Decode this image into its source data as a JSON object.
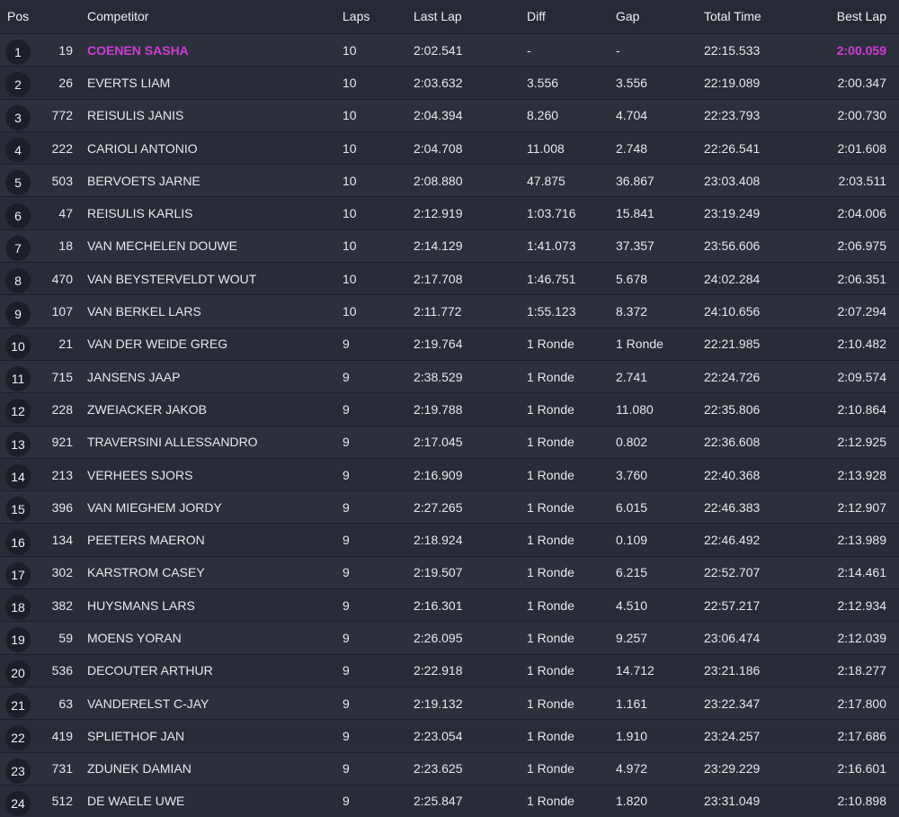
{
  "header": {
    "pos": "Pos",
    "competitor": "Competitor",
    "laps": "Laps",
    "last_lap": "Last Lap",
    "diff": "Diff",
    "gap": "Gap",
    "total_time": "Total Time",
    "best_lap": "Best Lap"
  },
  "colors": {
    "background": "#252a34",
    "row_odd": "#2b303b",
    "row_even": "#272c36",
    "highlight": "#d13ad6",
    "badge": "#1b1f27"
  },
  "rows": [
    {
      "pos": "1",
      "number": "19",
      "name": "COENEN SASHA",
      "laps": "10",
      "last_lap": "2:02.541",
      "diff": "-",
      "gap": "-",
      "total_time": "22:15.533",
      "best_lap": "2:00.059",
      "highlight": true
    },
    {
      "pos": "2",
      "number": "26",
      "name": "EVERTS LIAM",
      "laps": "10",
      "last_lap": "2:03.632",
      "diff": "3.556",
      "gap": "3.556",
      "total_time": "22:19.089",
      "best_lap": "2:00.347"
    },
    {
      "pos": "3",
      "number": "772",
      "name": "REISULIS JANIS",
      "laps": "10",
      "last_lap": "2:04.394",
      "diff": "8.260",
      "gap": "4.704",
      "total_time": "22:23.793",
      "best_lap": "2:00.730"
    },
    {
      "pos": "4",
      "number": "222",
      "name": "CARIOLI ANTONIO",
      "laps": "10",
      "last_lap": "2:04.708",
      "diff": "11.008",
      "gap": "2.748",
      "total_time": "22:26.541",
      "best_lap": "2:01.608"
    },
    {
      "pos": "5",
      "number": "503",
      "name": "BERVOETS JARNE",
      "laps": "10",
      "last_lap": "2:08.880",
      "diff": "47.875",
      "gap": "36.867",
      "total_time": "23:03.408",
      "best_lap": "2:03.511"
    },
    {
      "pos": "6",
      "number": "47",
      "name": "REISULIS KARLIS",
      "laps": "10",
      "last_lap": "2:12.919",
      "diff": "1:03.716",
      "gap": "15.841",
      "total_time": "23:19.249",
      "best_lap": "2:04.006"
    },
    {
      "pos": "7",
      "number": "18",
      "name": "VAN MECHELEN DOUWE",
      "laps": "10",
      "last_lap": "2:14.129",
      "diff": "1:41.073",
      "gap": "37.357",
      "total_time": "23:56.606",
      "best_lap": "2:06.975"
    },
    {
      "pos": "8",
      "number": "470",
      "name": "VAN BEYSTERVELDT WOUT",
      "laps": "10",
      "last_lap": "2:17.708",
      "diff": "1:46.751",
      "gap": "5.678",
      "total_time": "24:02.284",
      "best_lap": "2:06.351"
    },
    {
      "pos": "9",
      "number": "107",
      "name": "VAN BERKEL LARS",
      "laps": "10",
      "last_lap": "2:11.772",
      "diff": "1:55.123",
      "gap": "8.372",
      "total_time": "24:10.656",
      "best_lap": "2:07.294"
    },
    {
      "pos": "10",
      "number": "21",
      "name": "VAN DER WEIDE GREG",
      "laps": "9",
      "last_lap": "2:19.764",
      "diff": "1 Ronde",
      "gap": "1 Ronde",
      "total_time": "22:21.985",
      "best_lap": "2:10.482"
    },
    {
      "pos": "11",
      "number": "715",
      "name": "JANSENS JAAP",
      "laps": "9",
      "last_lap": "2:38.529",
      "diff": "1 Ronde",
      "gap": "2.741",
      "total_time": "22:24.726",
      "best_lap": "2:09.574"
    },
    {
      "pos": "12",
      "number": "228",
      "name": "ZWEIACKER JAKOB",
      "laps": "9",
      "last_lap": "2:19.788",
      "diff": "1 Ronde",
      "gap": "11.080",
      "total_time": "22:35.806",
      "best_lap": "2:10.864"
    },
    {
      "pos": "13",
      "number": "921",
      "name": "TRAVERSINI ALLESSANDRO",
      "laps": "9",
      "last_lap": "2:17.045",
      "diff": "1 Ronde",
      "gap": "0.802",
      "total_time": "22:36.608",
      "best_lap": "2:12.925"
    },
    {
      "pos": "14",
      "number": "213",
      "name": "VERHEES SJORS",
      "laps": "9",
      "last_lap": "2:16.909",
      "diff": "1 Ronde",
      "gap": "3.760",
      "total_time": "22:40.368",
      "best_lap": "2:13.928"
    },
    {
      "pos": "15",
      "number": "396",
      "name": "VAN MIEGHEM JORDY",
      "laps": "9",
      "last_lap": "2:27.265",
      "diff": "1 Ronde",
      "gap": "6.015",
      "total_time": "22:46.383",
      "best_lap": "2:12.907"
    },
    {
      "pos": "16",
      "number": "134",
      "name": "PEETERS MAERON",
      "laps": "9",
      "last_lap": "2:18.924",
      "diff": "1 Ronde",
      "gap": "0.109",
      "total_time": "22:46.492",
      "best_lap": "2:13.989"
    },
    {
      "pos": "17",
      "number": "302",
      "name": "KARSTROM CASEY",
      "laps": "9",
      "last_lap": "2:19.507",
      "diff": "1 Ronde",
      "gap": "6.215",
      "total_time": "22:52.707",
      "best_lap": "2:14.461"
    },
    {
      "pos": "18",
      "number": "382",
      "name": "HUYSMANS LARS",
      "laps": "9",
      "last_lap": "2:16.301",
      "diff": "1 Ronde",
      "gap": "4.510",
      "total_time": "22:57.217",
      "best_lap": "2:12.934"
    },
    {
      "pos": "19",
      "number": "59",
      "name": "MOENS YORAN",
      "laps": "9",
      "last_lap": "2:26.095",
      "diff": "1 Ronde",
      "gap": "9.257",
      "total_time": "23:06.474",
      "best_lap": "2:12.039"
    },
    {
      "pos": "20",
      "number": "536",
      "name": "DECOUTER ARTHUR",
      "laps": "9",
      "last_lap": "2:22.918",
      "diff": "1 Ronde",
      "gap": "14.712",
      "total_time": "23:21.186",
      "best_lap": "2:18.277"
    },
    {
      "pos": "21",
      "number": "63",
      "name": "VANDERELST C-JAY",
      "laps": "9",
      "last_lap": "2:19.132",
      "diff": "1 Ronde",
      "gap": "1.161",
      "total_time": "23:22.347",
      "best_lap": "2:17.800"
    },
    {
      "pos": "22",
      "number": "419",
      "name": "SPLIETHOF JAN",
      "laps": "9",
      "last_lap": "2:23.054",
      "diff": "1 Ronde",
      "gap": "1.910",
      "total_time": "23:24.257",
      "best_lap": "2:17.686"
    },
    {
      "pos": "23",
      "number": "731",
      "name": "ZDUNEK DAMIAN",
      "laps": "9",
      "last_lap": "2:23.625",
      "diff": "1 Ronde",
      "gap": "4.972",
      "total_time": "23:29.229",
      "best_lap": "2:16.601"
    },
    {
      "pos": "24",
      "number": "512",
      "name": "DE WAELE UWE",
      "laps": "9",
      "last_lap": "2:25.847",
      "diff": "1 Ronde",
      "gap": "1.820",
      "total_time": "23:31.049",
      "best_lap": "2:10.898"
    }
  ]
}
